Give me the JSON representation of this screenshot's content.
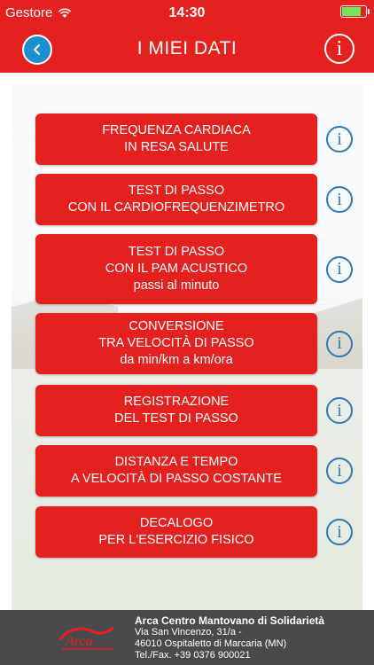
{
  "status_bar": {
    "carrier": "Gestore",
    "time": "14:30",
    "battery_level": 0.85
  },
  "nav": {
    "title": "I MIEI DATI",
    "back_icon": "chevron-left-icon",
    "info_icon": "info-icon"
  },
  "menu": [
    {
      "lines": [
        "FREQUENZA CARDIACA",
        "IN RESA SALUTE"
      ]
    },
    {
      "lines": [
        "TEST DI PASSO",
        "CON IL CARDIOFREQUENZIMETRO"
      ]
    },
    {
      "lines": [
        "TEST DI PASSO",
        "CON IL PAM ACUSTICO",
        "passi al minuto"
      ]
    },
    {
      "lines": [
        "CONVERSIONE",
        "TRA VELOCITÀ DI PASSO",
        "da min/km a km/ora"
      ]
    },
    {
      "lines": [
        "REGISTRAZIONE",
        "DEL TEST DI PASSO"
      ]
    },
    {
      "lines": [
        "DISTANZA E TEMPO",
        "A VELOCITÀ DI PASSO COSTANTE"
      ]
    },
    {
      "lines": [
        "DECALOGO",
        "PER L'ESERCIZIO FISICO"
      ]
    }
  ],
  "info_glyph": "i",
  "footer": {
    "logo_text": "Arca",
    "org_name": "Arca Centro Mantovano di Solidarietà",
    "address1": "Via San Vincenzo, 31/a -",
    "address2": "46010 Ospitaletto di Marcaria (MN)",
    "phone": "Tel./Fax. +39 0376 900021"
  },
  "colors": {
    "primary": "#e52120",
    "info_blue": "#2f78b4",
    "footer_bg": "#4a4a4c"
  }
}
